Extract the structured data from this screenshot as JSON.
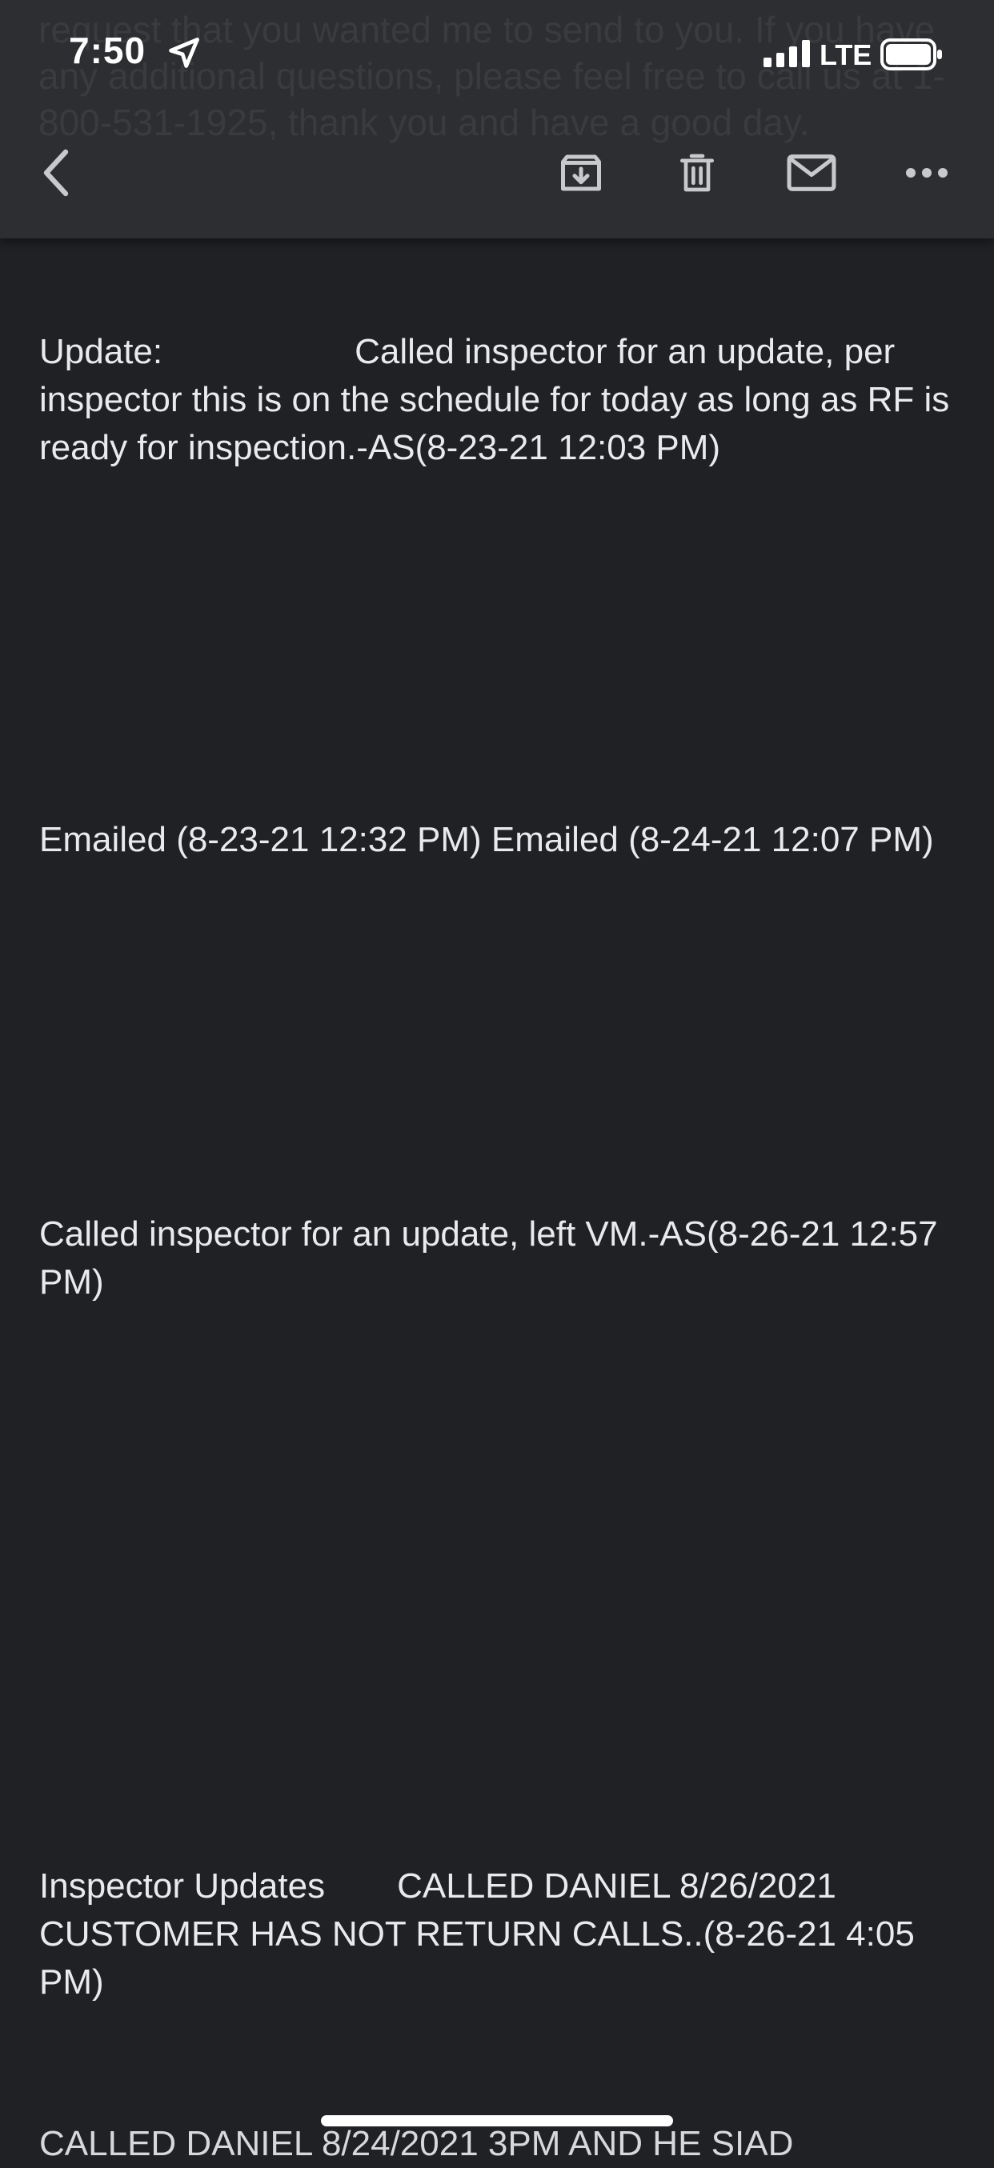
{
  "status_bar": {
    "time": "7:50",
    "network": "LTE",
    "icons": [
      "location-arrow-icon",
      "signal-icon",
      "battery-icon"
    ]
  },
  "header": {
    "ghost_text": "request that you wanted me to send to you. If you have any additional questions, please feel free to call us at 1-800-531-1925, thank you and have a good day.",
    "icons": [
      "back-icon",
      "archive-icon",
      "trash-icon",
      "mail-icon",
      "more-icon"
    ]
  },
  "messages": [
    {
      "label": "Update:",
      "text": "Called inspector for an update, per inspector this is on the schedule for today as long as RF is ready for inspection.-AS(8-23-21 12:03 PM)"
    },
    {
      "text": "Emailed (8-23-21 12:32 PM) Emailed (8-24-21 12:07 PM)"
    },
    {
      "text": "Called inspector for an update, left VM.-AS(8-26-21 12:57 PM)"
    },
    {
      "label": "Inspector Updates",
      "text": "CALLED DANIEL 8/26/2021 CUSTOMER HAS NOT RETURN CALLS..(8-26-21 4:05 PM)"
    },
    {
      "text": "CALLED DANIEL 8/24/2021 3PM AND HE SIAD"
    }
  ],
  "colors": {
    "background": "#202124",
    "header": "#2d2e31",
    "text": "#e8eaed"
  }
}
